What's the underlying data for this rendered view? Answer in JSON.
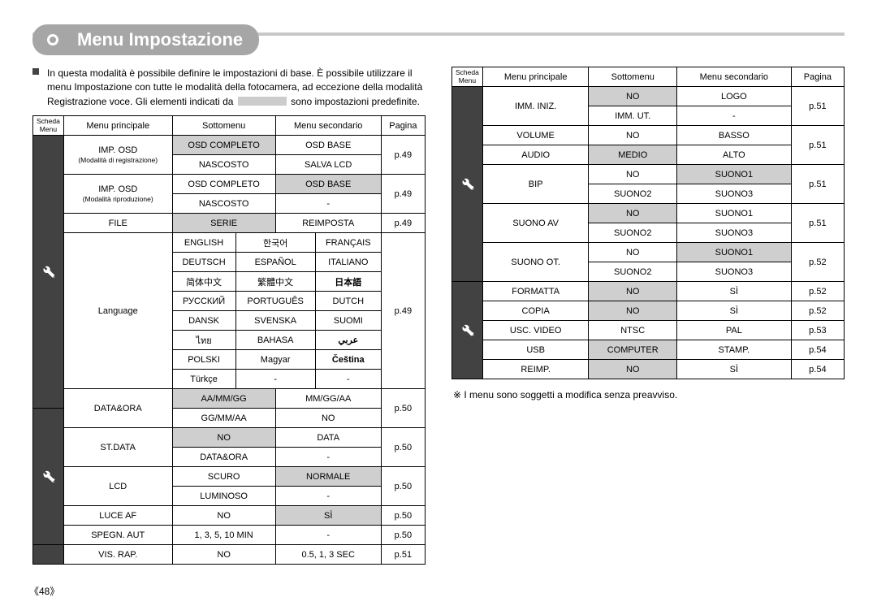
{
  "title": "Menu Impostazione",
  "intro": {
    "t1": "In questa modalità è possibile definire le impostazioni di base. È possibile utilizzare il",
    "t2": "menu Impostazione con tutte le modalità della fotocamera, ad eccezione della modalità",
    "t3a": "Registrazione voce. Gli elementi indicati da",
    "t3b": "sono impostazioni predefinite."
  },
  "hdr": {
    "tab": "Scheda Menu",
    "main": "Menu principale",
    "sub": "Sottomenu",
    "sec": "Menu secondario",
    "pg": "Pagina"
  },
  "left": {
    "r1m": "IMP. OSD",
    "r1n": "(Modalità di registrazione)",
    "r1s1": "OSD COMPLETO",
    "r1c1": "OSD BASE",
    "r1s2": "NASCOSTO",
    "r1c2": "SALVA LCD",
    "r1p": "p.49",
    "r2m": "IMP. OSD",
    "r2n": "(Modalità riproduzione)",
    "r2s1": "OSD COMPLETO",
    "r2c1": "OSD BASE",
    "r2s2": "NASCOSTO",
    "r2c2": "-",
    "r2p": "p.49",
    "r3m": "FILE",
    "r3s": "SERIE",
    "r3c": "REIMPOSTA",
    "r3p": "p.49",
    "lang_m": "Language",
    "lang_p": "p.49",
    "lang": [
      [
        "ENGLISH",
        "한국어",
        "FRANÇAIS"
      ],
      [
        "DEUTSCH",
        "ESPAÑOL",
        "ITALIANO"
      ],
      [
        "简体中文",
        "繁體中文",
        "日本語"
      ],
      [
        "РУССКИЙ",
        "PORTUGUÊS",
        "DUTCH"
      ],
      [
        "DANSK",
        "SVENSKA",
        "SUOMI"
      ],
      [
        "ไทย",
        "BAHASA",
        "عربي"
      ],
      [
        "POLSKI",
        "Magyar",
        "Čeština"
      ],
      [
        "Türkçe",
        "-",
        "-"
      ]
    ],
    "date_m": "DATA&ORA",
    "date_s1": "AA/MM/GG",
    "date_c1": "MM/GG/AA",
    "date_s2": "GG/MM/AA",
    "date_c2": "NO",
    "date_p": "p.50",
    "std_m": "ST.DATA",
    "std_s1": "NO",
    "std_c1": "DATA",
    "std_s2": "DATA&ORA",
    "std_c2": "-",
    "std_p": "p.50",
    "lcd_m": "LCD",
    "lcd_s1": "SCURO",
    "lcd_c1": "NORMALE",
    "lcd_s2": "LUMINOSO",
    "lcd_c2": "-",
    "lcd_p": "p.50",
    "af_m": "LUCE AF",
    "af_s": "NO",
    "af_c": "SÌ",
    "af_p": "p.50",
    "sp_m": "SPEGN. AUT",
    "sp_s": "1, 3, 5, 10 MIN",
    "sp_c": "-",
    "sp_p": "p.50",
    "vr_m": "VIS. RAP.",
    "vr_s": "NO",
    "vr_c": "0.5, 1, 3 SEC",
    "vr_p": "p.51"
  },
  "right": {
    "im_m": "IMM. INIZ.",
    "im_s1": "NO",
    "im_c1": "LOGO",
    "im_s2": "IMM. UT.",
    "im_c2": "-",
    "im_p": "p.51",
    "vo_m": "VOLUME",
    "vo_s": "NO",
    "vo_c": "BASSO",
    "vo_p": "p.51",
    "au_m": "AUDIO",
    "au_s": "MEDIO",
    "au_c": "ALTO",
    "bi_m": "BIP",
    "bi_s1": "NO",
    "bi_c1": "SUONO1",
    "bi_s2": "SUONO2",
    "bi_c2": "SUONO3",
    "bi_p": "p.51",
    "sa_m": "SUONO AV",
    "sa_s1": "NO",
    "sa_c1": "SUONO1",
    "sa_s2": "SUONO2",
    "sa_c2": "SUONO3",
    "sa_p": "p.51",
    "so_m": "SUONO OT.",
    "so_s1": "NO",
    "so_c1": "SUONO1",
    "so_s2": "SUONO2",
    "so_c2": "SUONO3",
    "so_p": "p.52",
    "fm_m": "FORMATTA",
    "fm_s": "NO",
    "fm_c": "SÌ",
    "fm_p": "p.52",
    "cp_m": "COPIA",
    "cp_s": "NO",
    "cp_c": "SÌ",
    "cp_p": "p.52",
    "uv_m": "USC. VIDEO",
    "uv_s": "NTSC",
    "uv_c": "PAL",
    "uv_p": "p.53",
    "us_m": "USB",
    "us_s": "COMPUTER",
    "us_c": "STAMP.",
    "us_p": "p.54",
    "re_m": "REIMP.",
    "re_s": "NO",
    "re_c": "SÌ",
    "re_p": "p.54"
  },
  "note": "※ I menu sono soggetti a modifica senza preavviso.",
  "pageNum": "《48》"
}
